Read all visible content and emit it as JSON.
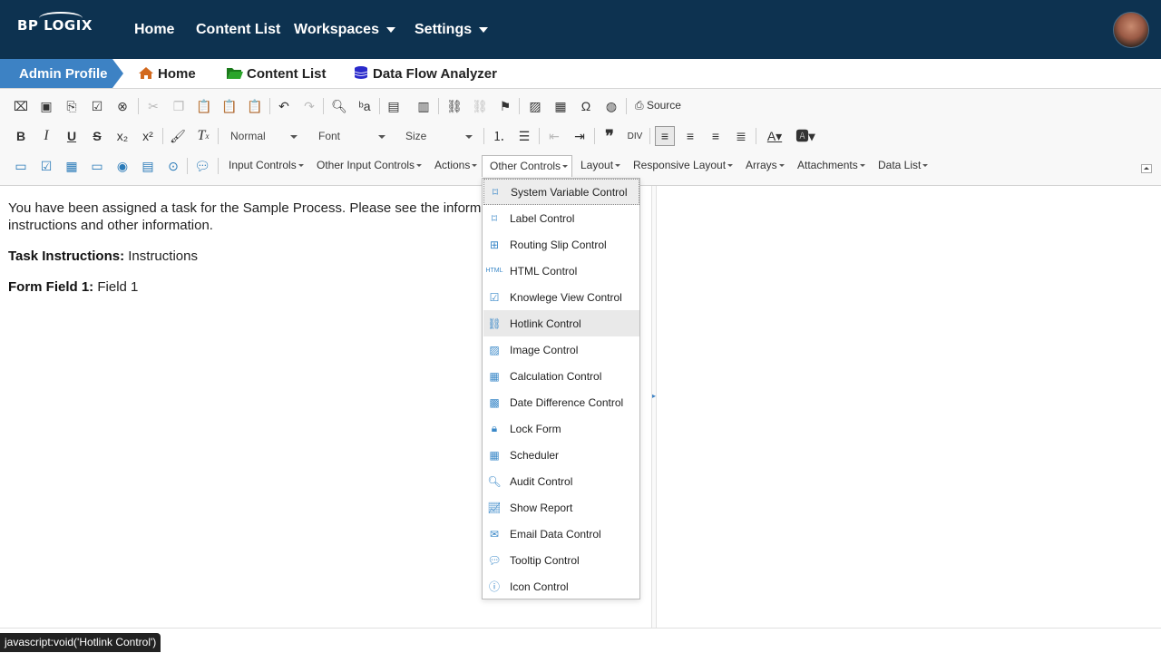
{
  "nav": {
    "logo": "BP LOGIX",
    "home": "Home",
    "content_list": "Content List",
    "workspaces": "Workspaces",
    "settings": "Settings"
  },
  "tabs": {
    "active": "Admin Profile",
    "home": "Home",
    "content_list": "Content List",
    "data_flow": "Data Flow Analyzer"
  },
  "toolbar": {
    "source": "Source",
    "format": "Normal",
    "font": "Font",
    "size": "Size",
    "menus": [
      "Input Controls",
      "Other Input Controls",
      "Actions",
      "Other Controls",
      "Layout",
      "Responsive Layout",
      "Arrays",
      "Attachments",
      "Data List"
    ]
  },
  "document": {
    "intro": "You have been assigned a task for the Sample Process. Please see the informa",
    "intro2": "instructions and other information.",
    "task_label": "Task Instructions:",
    "task_value": " Instructions",
    "field_label": "Form Field 1:",
    "field_value": " Field 1"
  },
  "dropdown": {
    "items": [
      {
        "label": "System Variable Control",
        "icon": "tag-icon"
      },
      {
        "label": "Label Control",
        "icon": "tag-icon"
      },
      {
        "label": "Routing Slip Control",
        "icon": "sitemap-icon"
      },
      {
        "label": "HTML Control",
        "icon": "html-icon"
      },
      {
        "label": "Knowlege View Control",
        "icon": "checkbox-icon"
      },
      {
        "label": "Hotlink Control",
        "icon": "link-icon"
      },
      {
        "label": "Image Control",
        "icon": "image-icon"
      },
      {
        "label": "Calculation Control",
        "icon": "calculator-icon"
      },
      {
        "label": "Date Difference Control",
        "icon": "date-diff-icon"
      },
      {
        "label": "Lock Form",
        "icon": "lock-icon"
      },
      {
        "label": "Scheduler",
        "icon": "calendar-icon"
      },
      {
        "label": "Audit Control",
        "icon": "search-icon"
      },
      {
        "label": "Show Report",
        "icon": "chart-icon"
      },
      {
        "label": "Email Data Control",
        "icon": "envelope-icon"
      },
      {
        "label": "Tooltip Control",
        "icon": "comment-icon"
      },
      {
        "label": "Icon Control",
        "icon": "info-icon"
      }
    ]
  },
  "status": "javascript:void('Hotlink Control')",
  "colors": {
    "nav_bg": "#0d3250",
    "active_tab": "#3d82c4",
    "accent": "#2a7ab8"
  }
}
